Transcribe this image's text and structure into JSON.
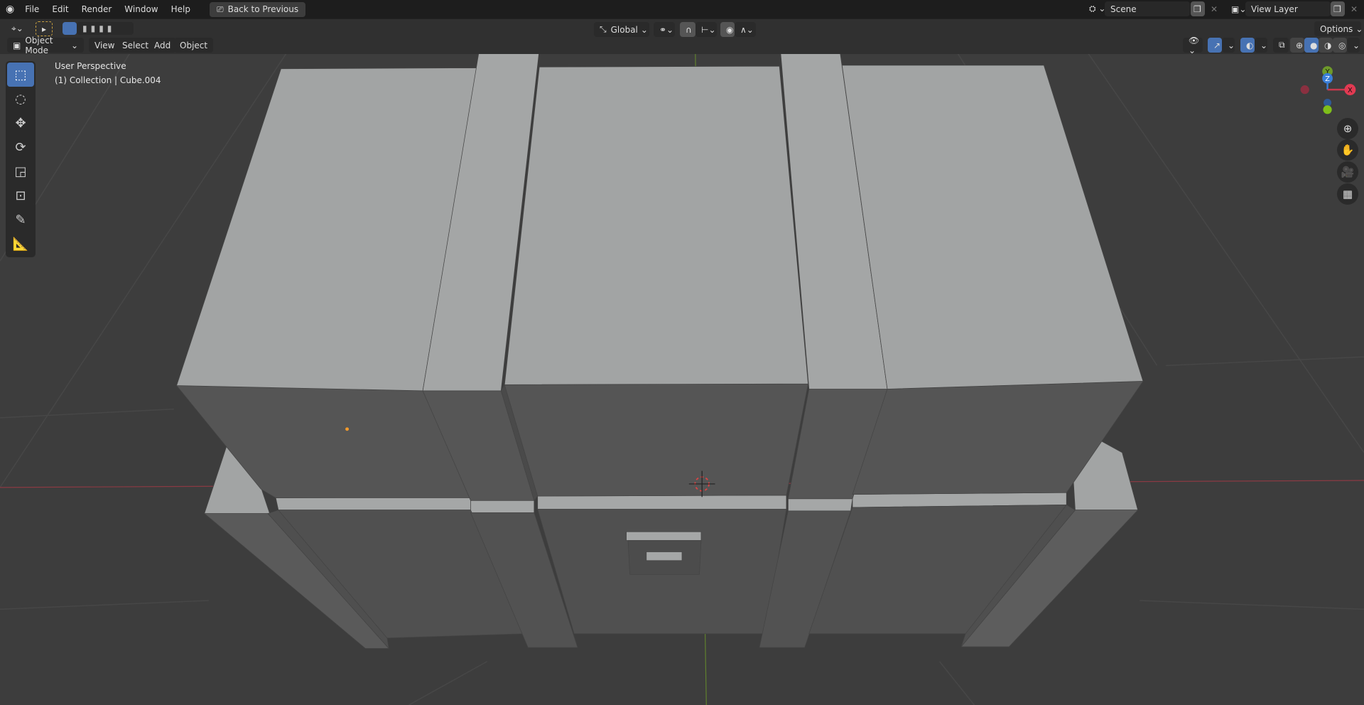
{
  "topbar": {
    "menus": [
      "File",
      "Edit",
      "Render",
      "Window",
      "Help"
    ],
    "back_button": "Back to Previous",
    "scene": "Scene",
    "view_layer": "View Layer"
  },
  "header": {
    "mode": "Object Mode",
    "menus": [
      "View",
      "Select",
      "Add",
      "Object"
    ],
    "orientation": "Global",
    "options": "Options"
  },
  "viewport": {
    "view_name": "User Perspective",
    "collection_info": "(1) Collection | Cube.004"
  },
  "gizmo": {
    "x": "X",
    "y": "Y",
    "z": "Z"
  },
  "colors": {
    "accent": "#4772b3",
    "background": "#3d3d3d",
    "x_axis": "#c8384d",
    "y_axis": "#6e9a2a",
    "z_axis": "#3a7ed8"
  }
}
